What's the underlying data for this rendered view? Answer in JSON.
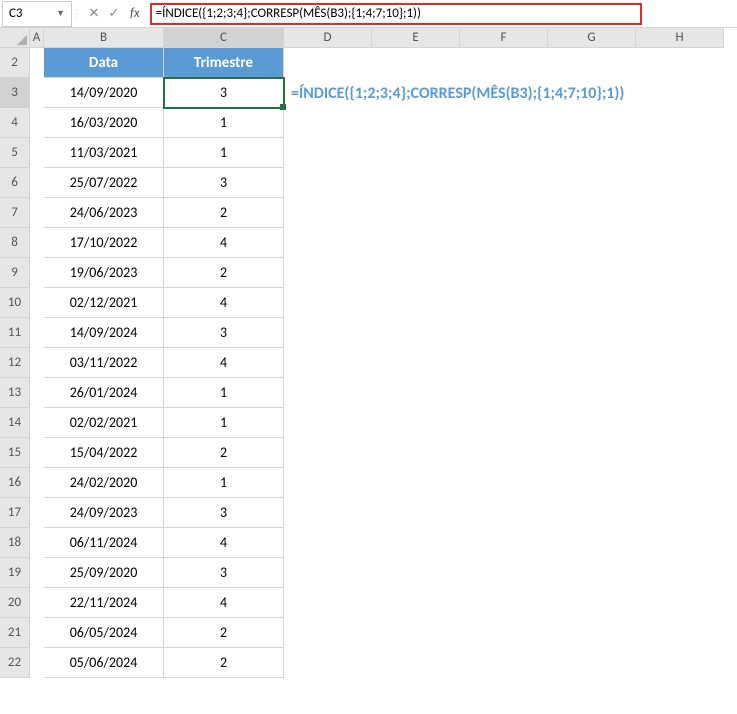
{
  "nameBox": "C3",
  "formulaBar": "=ÍNDICE({1;2;3;4};CORRESP(MÊS(B3);{1;4;7;10};1))",
  "overlayFormula": "=ÍNDICE({1;2;3;4};CORRESP(MÊS(B3);{1;4;7;10};1))",
  "columns": [
    "A",
    "B",
    "C",
    "D",
    "E",
    "F",
    "G",
    "H"
  ],
  "headers": {
    "B": "Data",
    "C": "Trimestre"
  },
  "rows": [
    {
      "num": "2",
      "B": "",
      "C": "",
      "isHeader": true
    },
    {
      "num": "3",
      "B": "14/09/2020",
      "C": "3"
    },
    {
      "num": "4",
      "B": "16/03/2020",
      "C": "1"
    },
    {
      "num": "5",
      "B": "11/03/2021",
      "C": "1"
    },
    {
      "num": "6",
      "B": "25/07/2022",
      "C": "3"
    },
    {
      "num": "7",
      "B": "24/06/2023",
      "C": "2"
    },
    {
      "num": "8",
      "B": "17/10/2022",
      "C": "4"
    },
    {
      "num": "9",
      "B": "19/06/2023",
      "C": "2"
    },
    {
      "num": "10",
      "B": "02/12/2021",
      "C": "4"
    },
    {
      "num": "11",
      "B": "14/09/2024",
      "C": "3"
    },
    {
      "num": "12",
      "B": "03/11/2022",
      "C": "4"
    },
    {
      "num": "13",
      "B": "26/01/2024",
      "C": "1"
    },
    {
      "num": "14",
      "B": "02/02/2021",
      "C": "1"
    },
    {
      "num": "15",
      "B": "15/04/2022",
      "C": "2"
    },
    {
      "num": "16",
      "B": "24/02/2020",
      "C": "1"
    },
    {
      "num": "17",
      "B": "24/09/2023",
      "C": "3"
    },
    {
      "num": "18",
      "B": "06/11/2024",
      "C": "4"
    },
    {
      "num": "19",
      "B": "25/09/2020",
      "C": "3"
    },
    {
      "num": "20",
      "B": "22/11/2024",
      "C": "4"
    },
    {
      "num": "21",
      "B": "06/05/2024",
      "C": "2"
    },
    {
      "num": "22",
      "B": "05/06/2024",
      "C": "2"
    }
  ],
  "activeCell": "C3",
  "selectedCol": "C",
  "selectedRow": "3"
}
